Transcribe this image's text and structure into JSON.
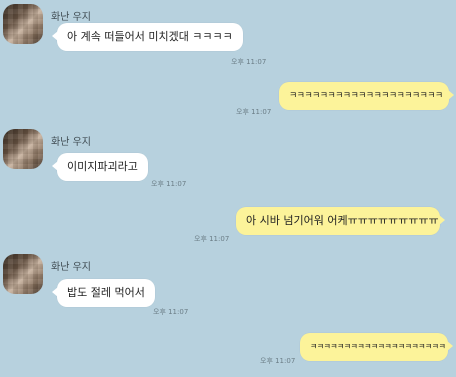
{
  "messages": [
    {
      "direction": "in",
      "sender": "화난 우지",
      "text": "아 계속 떠들어서 미치겠대 ㅋㅋㅋㅋ",
      "time": "오후 11:07"
    },
    {
      "direction": "out",
      "text": "ㅋㅋㅋㅋㅋㅋㅋㅋㅋㅋㅋㅋㅋㅋㅋㅋㅋㅋㅋㅋ",
      "time": "오후 11:07"
    },
    {
      "direction": "in",
      "sender": "화난 우지",
      "text": "이미지파괴라고",
      "time": "오후 11:07"
    },
    {
      "direction": "out",
      "text": "아 시바 넘기어워 어케ㅠㅠㅠㅠㅠㅠㅠㅠㅠ",
      "time": "오후 11:07"
    },
    {
      "direction": "in",
      "sender": "화난 우지",
      "text": "밥도 절레 먹어서",
      "time": "오후 11:07"
    },
    {
      "direction": "out",
      "text": "ㅋㅋㅋㅋㅋㅋㅋㅋㅋㅋㅋㅋㅋㅋㅋㅋㅋㅋㅋㅋ",
      "time": "오후 11:07"
    }
  ],
  "colors": {
    "background": "#b7d1de",
    "incoming_bubble": "#ffffff",
    "outgoing_bubble": "#fcf39a"
  }
}
